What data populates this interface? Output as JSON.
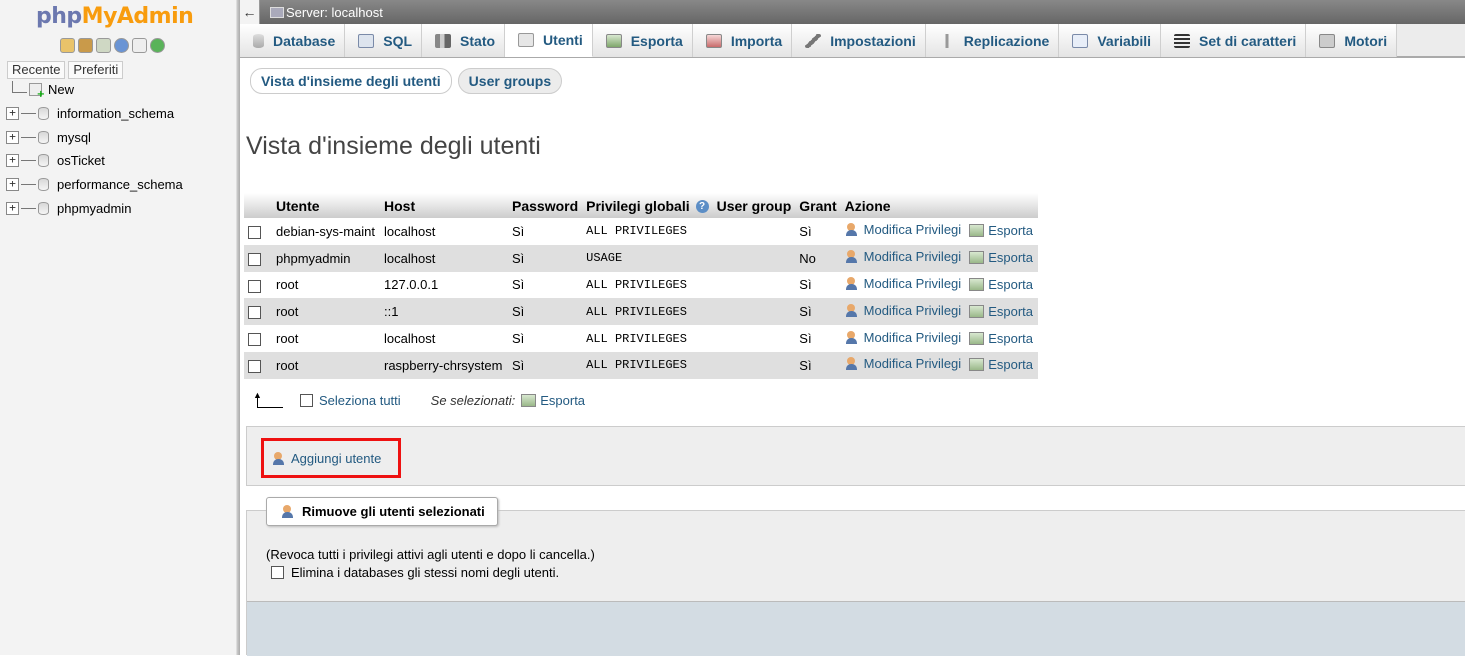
{
  "nav": {
    "logo_php": "php",
    "logo_myadmin": "MyAdmin",
    "quick_icons": [
      "home-icon",
      "exit-icon",
      "sql-query-icon",
      "docs-icon",
      "copy-icon",
      "reload-icon"
    ],
    "tab_recent": "Recente",
    "tab_favorites": "Preferiti",
    "tree": {
      "new": "New",
      "databases": [
        "information_schema",
        "mysql",
        "osTicket",
        "performance_schema",
        "phpmyadmin"
      ]
    }
  },
  "serverbar": {
    "back": "←",
    "title": "Server: localhost"
  },
  "topmenu": [
    {
      "label": "Database",
      "icon": "database-icon"
    },
    {
      "label": "SQL",
      "icon": "sql-icon"
    },
    {
      "label": "Stato",
      "icon": "status-icon"
    },
    {
      "label": "Utenti",
      "icon": "users-icon"
    },
    {
      "label": "Esporta",
      "icon": "export-icon"
    },
    {
      "label": "Importa",
      "icon": "import-icon"
    },
    {
      "label": "Impostazioni",
      "icon": "settings-icon"
    },
    {
      "label": "Replicazione",
      "icon": "replication-icon"
    },
    {
      "label": "Variabili",
      "icon": "variables-icon"
    },
    {
      "label": "Set di caratteri",
      "icon": "charset-icon"
    },
    {
      "label": "Motori",
      "icon": "engines-icon"
    }
  ],
  "subtabs": {
    "overview": "Vista d'insieme degli utenti",
    "groups": "User groups"
  },
  "page_title": "Vista d'insieme degli utenti",
  "table": {
    "headers": [
      "Utente",
      "Host",
      "Password",
      "Privilegi globali",
      "User group",
      "Grant",
      "Azione"
    ],
    "rows": [
      {
        "user": "debian-sys-maint",
        "host": "localhost",
        "password": "Sì",
        "privileges": "ALL PRIVILEGES",
        "group": "",
        "grant": "Sì"
      },
      {
        "user": "phpmyadmin",
        "host": "localhost",
        "password": "Sì",
        "privileges": "USAGE",
        "group": "",
        "grant": "No"
      },
      {
        "user": "root",
        "host": "127.0.0.1",
        "password": "Sì",
        "privileges": "ALL PRIVILEGES",
        "group": "",
        "grant": "Sì"
      },
      {
        "user": "root",
        "host": "::1",
        "password": "Sì",
        "privileges": "ALL PRIVILEGES",
        "group": "",
        "grant": "Sì"
      },
      {
        "user": "root",
        "host": "localhost",
        "password": "Sì",
        "privileges": "ALL PRIVILEGES",
        "group": "",
        "grant": "Sì"
      },
      {
        "user": "root",
        "host": "raspberry-chrsystem",
        "password": "Sì",
        "privileges": "ALL PRIVILEGES",
        "group": "",
        "grant": "Sì"
      }
    ],
    "edit_label": "Modifica Privilegi",
    "export_label": "Esporta"
  },
  "with_selected": {
    "select_all": "Seleziona tutti",
    "label": "Se selezionati:",
    "export": "Esporta"
  },
  "add_user": "Aggiungi utente",
  "remove": {
    "legend": "Rimuove gli utenti selezionati",
    "description": "(Revoca tutti i privilegi attivi agli utenti e dopo li cancella.)",
    "drop_db": "Elimina i databases gli stessi nomi degli utenti."
  }
}
